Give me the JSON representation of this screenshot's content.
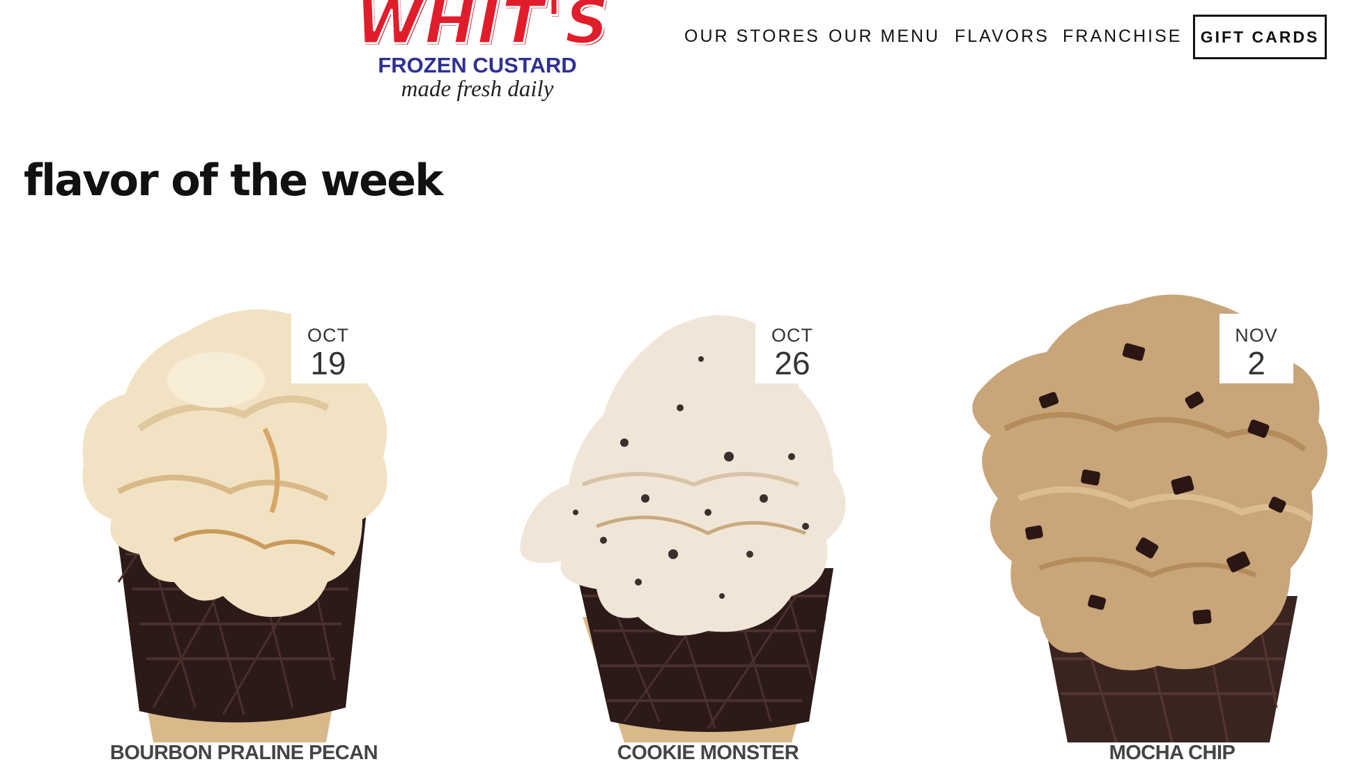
{
  "logo": {
    "wordmark": "WHIT'S",
    "subtitle": "FROZEN CUSTARD",
    "tagline": "made fresh daily",
    "colors": {
      "wordmark": "#e21d2b",
      "subtitle": "#2e3190"
    }
  },
  "nav": {
    "items": [
      {
        "label": "OUR STORES"
      },
      {
        "label": "OUR MENU"
      },
      {
        "label": "FLAVORS"
      },
      {
        "label": "FRANCHISE"
      }
    ],
    "cta_label": "GIFT CARDS"
  },
  "page": {
    "title": "flavor of the week"
  },
  "flavors": [
    {
      "name": "BOURBON PRALINE PECAN",
      "month": "OCT",
      "day": "19"
    },
    {
      "name": "COOKIE MONSTER",
      "month": "OCT",
      "day": "26"
    },
    {
      "name": "MOCHA CHIP",
      "month": "NOV",
      "day": "2"
    }
  ]
}
